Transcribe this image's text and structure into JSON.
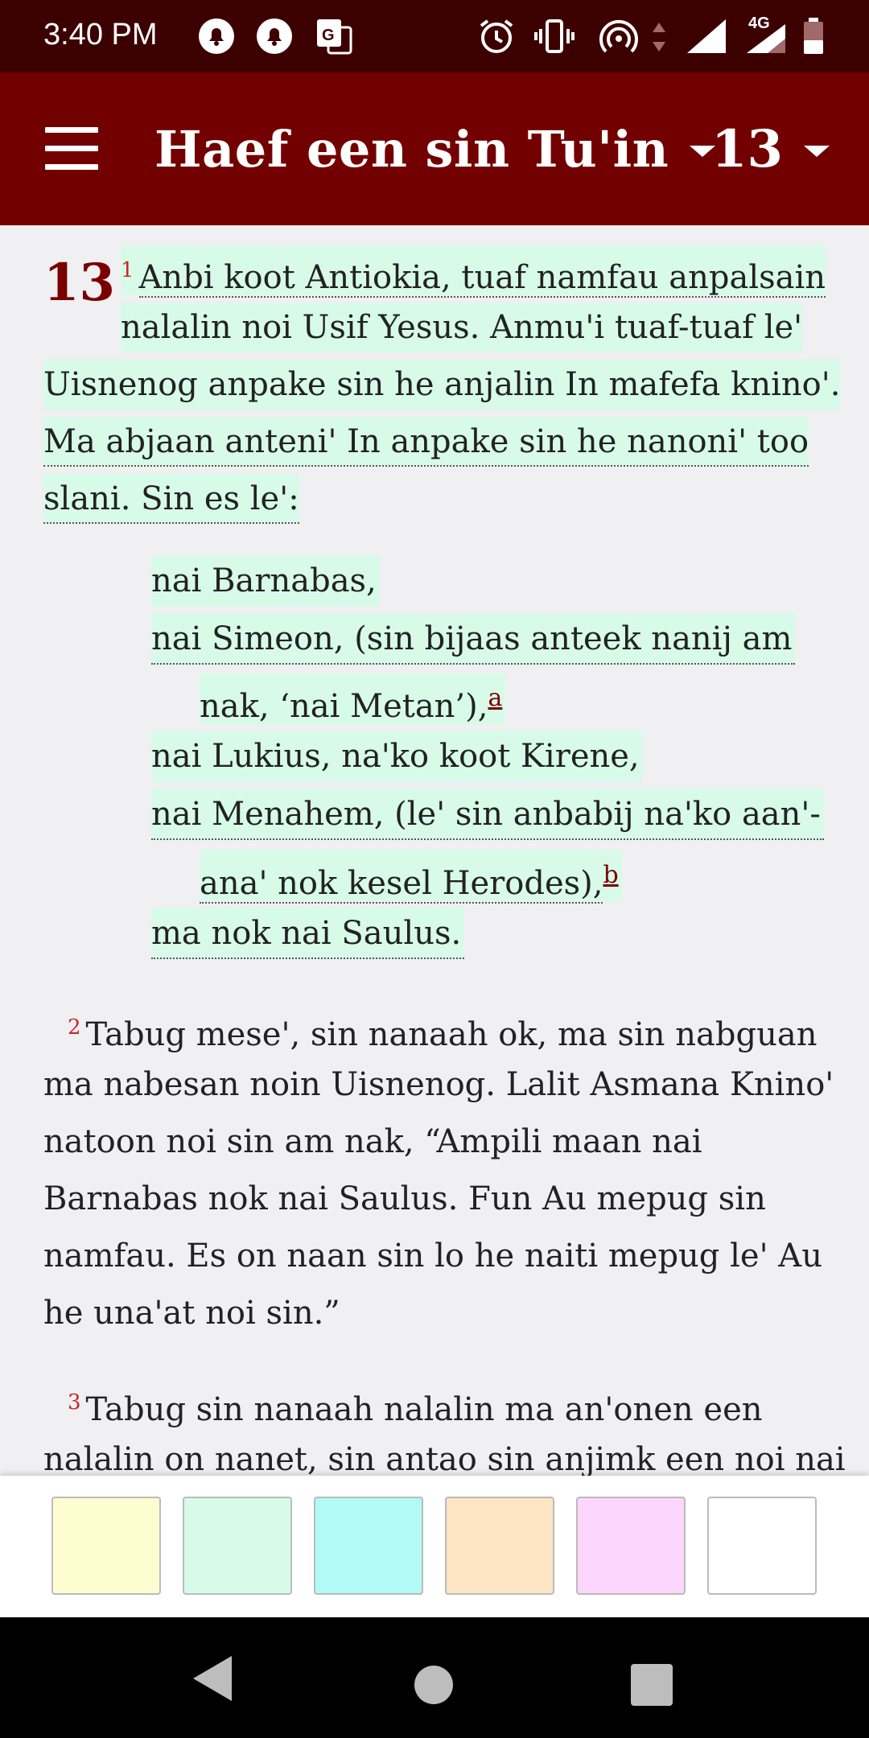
{
  "status_bar": {
    "time": "3:40 PM",
    "network": "4G",
    "icons": [
      "notification-bell-icon",
      "notification-bell-icon",
      "translate-icon",
      "alarm-icon",
      "vibrate-icon",
      "hotspot-icon",
      "data-arrows-icon",
      "signal-icon",
      "signal-4g-icon",
      "battery-icon"
    ]
  },
  "app_bar": {
    "menu_icon": "hamburger-menu-icon",
    "book_title": "Haef een sin Tu'in",
    "chapter": "13"
  },
  "content": {
    "chapter_number": "13",
    "verse1": {
      "number": "1",
      "lines": [
        "Anbi koot Antiokia, tuaf namfau anpalsain",
        "nalalin noi Usif Yesus. Anmu'i tuaf-tuaf le'",
        "Uisnenog anpake sin he anjalin In mafefa knino'.",
        "Ma abjaan anteni' In anpake sin he nanoni' too",
        "slani. Sin es le':"
      ]
    },
    "stanza": [
      {
        "text": "nai Barnabas,"
      },
      {
        "text": "nai Simeon, (sin bijaas anteek nanij am"
      },
      {
        "text": "nak, ‘nai Metan’),",
        "footnote": "a"
      },
      {
        "text": "nai Lukius, na'ko koot Kirene,"
      },
      {
        "text": "nai Menahem, (le' sin anbabij na'ko aan'-"
      },
      {
        "text": "ana' nok kesel Herodes),",
        "footnote": "b"
      },
      {
        "text": "ma nok nai Saulus."
      }
    ],
    "verse2": {
      "number": "2",
      "lines": [
        "Tabug mese', sin nanaah ok, ma sin nabguan",
        "ma nabesan noin Uisnenog. Lalit Asmana Knino'",
        "natoon noi sin am nak, “Ampili maan nai",
        "Barnabas nok nai Saulus. Fun Au mepug sin",
        "namfau. Es on naan sin lo he naiti mepug le' Au",
        "he una'at noi sin.”"
      ]
    },
    "verse3": {
      "number": "3",
      "lines": [
        "Tabug sin nanaah nalalin ma an'onen een",
        "nalalin on nanet, sin antao sin anjimk een noi nai"
      ]
    }
  },
  "highlight_colors": [
    "#fdfdd1",
    "#d8fbe9",
    "#b2faf6",
    "#fee5c3",
    "#fcd6fc",
    "#ffffff"
  ],
  "highlight_color": "#d8fbe9",
  "navigation": {
    "back_icon": "back-triangle-icon",
    "home_icon": "home-circle-icon",
    "recents_icon": "recents-square-icon"
  }
}
